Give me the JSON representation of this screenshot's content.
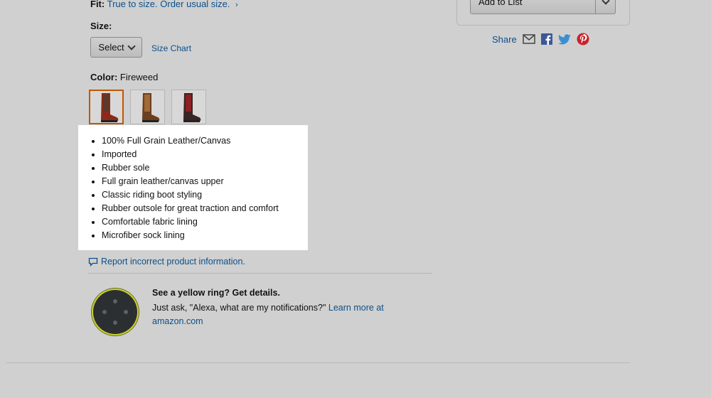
{
  "fit": {
    "label": "Fit:",
    "value": "True to size. Order usual size."
  },
  "size": {
    "label": "Size:",
    "select_label": "Select",
    "chart_link": "Size Chart"
  },
  "color": {
    "label": "Color:",
    "value": "Fireweed"
  },
  "swatches": [
    "brown-red riding boot",
    "brown riding boot",
    "dark red riding boot"
  ],
  "bullets": [
    "100% Full Grain Leather/Canvas",
    "Imported",
    "Rubber sole",
    "Full grain leather/canvas upper",
    "Classic riding boot styling",
    "Rubber outsole for great traction and comfort",
    "Comfortable fabric lining",
    "Microfiber sock lining"
  ],
  "report": {
    "label": "Report incorrect product information."
  },
  "alexa": {
    "title": "See a yellow ring? Get details.",
    "text": "Just ask, \"Alexa, what are my notifications?\"",
    "link": "Learn more at amazon.com"
  },
  "buybox": {
    "add_to_list": "Add to List"
  },
  "share": {
    "label": "Share",
    "icons": [
      "email-icon",
      "facebook-icon",
      "twitter-icon",
      "pinterest-icon"
    ]
  },
  "colors": {
    "link": "#0b4f8a",
    "selected_border": "#c45500",
    "echo_ring": "#c9d22a",
    "background": "#d0d0d0"
  }
}
